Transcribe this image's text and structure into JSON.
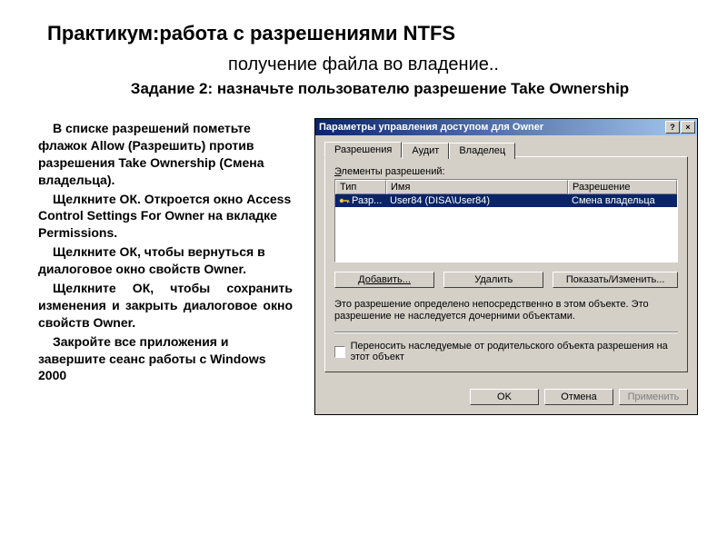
{
  "page": {
    "title": "Практикум:работа с разрешениями NTFS",
    "subtitle": "получение файла во владение..",
    "task": "Задание 2: назначьте пользователю разрешение Take Ownership",
    "body_paragraphs": [
      "В списке разрешений пометьте флажок Allow (Разрешить) против разрешения Take Ownership (Смена владельца).",
      "Щелкните ОК. Откроется окно Access Control Settings For Owner на вкладке Permissions.",
      "Щелкните ОК, чтобы вернуться в диалоговое окно свойств Owner.",
      "Щелкните ОК, чтобы сохранить изменения и закрыть диалоговое окно свойств Owner.",
      "Закройте все приложения и завершите сеанс работы с Windows 2000"
    ]
  },
  "dialog": {
    "title": "Параметры управления доступом для Owner",
    "win_help": "?",
    "win_close": "×",
    "tabs": [
      "Разрешения",
      "Аудит",
      "Владелец"
    ],
    "section_label_prefix": "Э",
    "section_label_rest": "лементы разрешений:",
    "columns": [
      "Тип",
      "Имя",
      "Разрешение"
    ],
    "row": {
      "type": "Разр...",
      "name": "User84 (DISA\\User84)",
      "perm": "Смена владельца"
    },
    "buttons": {
      "add": "Добавить...",
      "remove": "Удалить",
      "edit": "Показать/Изменить..."
    },
    "info": "Это разрешение определено непосредственно в этом объекте. Это разрешение не наследуется дочерними объектами.",
    "checkbox_label": "Переносить наследуемые от родительского объекта разрешения на этот объект",
    "footer": {
      "ok": "OK",
      "cancel": "Отмена",
      "apply": "Применить"
    }
  }
}
